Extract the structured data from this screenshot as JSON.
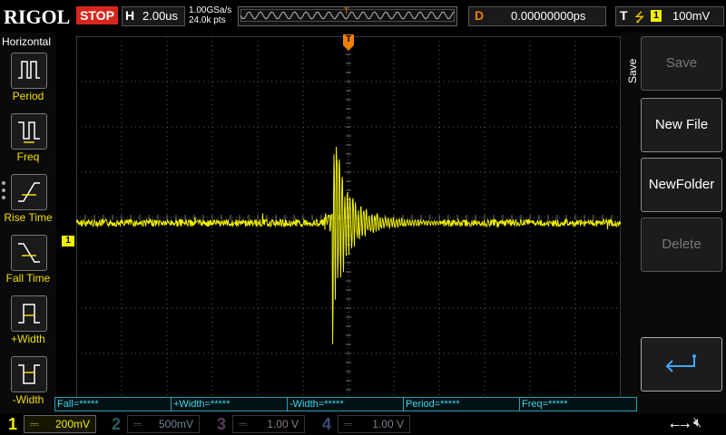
{
  "brand": "RIGOL",
  "run_state": "STOP",
  "timebase": {
    "letter": "H",
    "value": "2.00us"
  },
  "acquisition": {
    "sample_rate": "1.00GSa/s",
    "points": "24.0k pts"
  },
  "trigger_marker": "T",
  "delay": {
    "letter": "D",
    "value": "0.00000000ps"
  },
  "trigger": {
    "letter": "T",
    "edge": "rising-edge-icon",
    "source": "1",
    "level": "100mV"
  },
  "left_panel": {
    "title": "Horizontal",
    "items": [
      {
        "label": "Period",
        "icon": "period-icon"
      },
      {
        "label": "Freq",
        "icon": "frequency-icon"
      },
      {
        "label": "Rise Time",
        "icon": "rise-time-icon"
      },
      {
        "label": "Fall Time",
        "icon": "fall-time-icon"
      },
      {
        "label": "+Width",
        "icon": "positive-width-icon"
      },
      {
        "label": "-Width",
        "icon": "negative-width-icon"
      }
    ]
  },
  "right_menu": {
    "title": "Save",
    "items": [
      {
        "label": "Save",
        "enabled": false
      },
      {
        "label": "New File",
        "enabled": true
      },
      {
        "label": "NewFolder",
        "enabled": true
      },
      {
        "label": "Delete",
        "enabled": false
      }
    ],
    "return_icon": "return-arrow-icon"
  },
  "channel_marker": "1",
  "measurements": [
    "Fall=*****",
    "+Width=*****",
    "-Width=*****",
    "Period=*****",
    "Freq=*****"
  ],
  "channels": [
    {
      "num": "1",
      "coupling": "DC",
      "scale": "200mV",
      "color": "#f0f000",
      "active": true
    },
    {
      "num": "2",
      "coupling": "DC",
      "scale": "500mV",
      "color": "#00c8e0",
      "active": false
    },
    {
      "num": "3",
      "coupling": "DC",
      "scale": "1.00 V",
      "color": "#e040e0",
      "active": false
    },
    {
      "num": "4",
      "coupling": "DC",
      "scale": "1.00 V",
      "color": "#3060ff",
      "active": false
    }
  ],
  "colors": {
    "trace": "#f0f000",
    "trigger": "#f08000",
    "measure": "#3fd8e8",
    "grid": "#606060"
  },
  "status_icons": [
    "usb-icon",
    "speaker-mute-icon"
  ]
}
